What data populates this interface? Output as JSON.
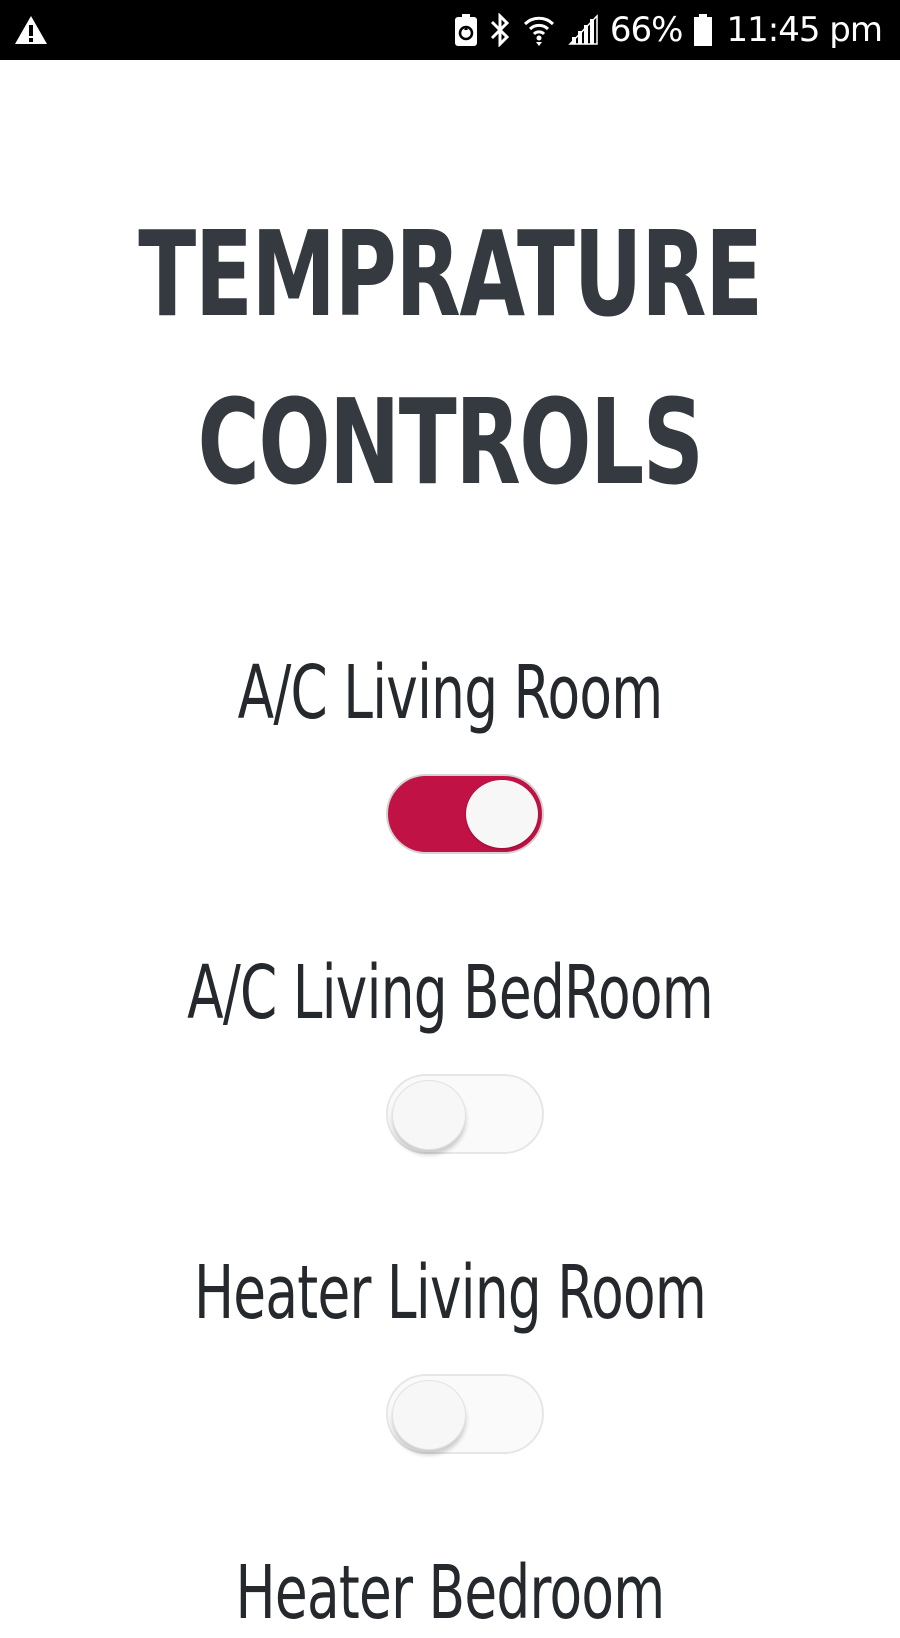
{
  "status_bar": {
    "battery_percent": "66%",
    "time": "11:45 pm",
    "icons": [
      "warning-icon",
      "battery-saver-icon",
      "bluetooth-icon",
      "wifi-icon",
      "cell-signal-icon",
      "battery-icon"
    ]
  },
  "page": {
    "title_line1": "TEMPRATURE",
    "title_line2": "CONTROLS"
  },
  "controls": [
    {
      "label": "A/C Living Room",
      "state": "on"
    },
    {
      "label": "A/C Living BedRoom",
      "state": "off"
    },
    {
      "label": "Heater Living Room",
      "state": "off"
    },
    {
      "label": "Heater Bedroom",
      "state": "off"
    }
  ],
  "colors": {
    "toggle_on": "#c01245",
    "toggle_off": "#fafafa",
    "title_text": "#343a40",
    "label_text": "#25282c",
    "status_bar_bg": "#000000"
  }
}
